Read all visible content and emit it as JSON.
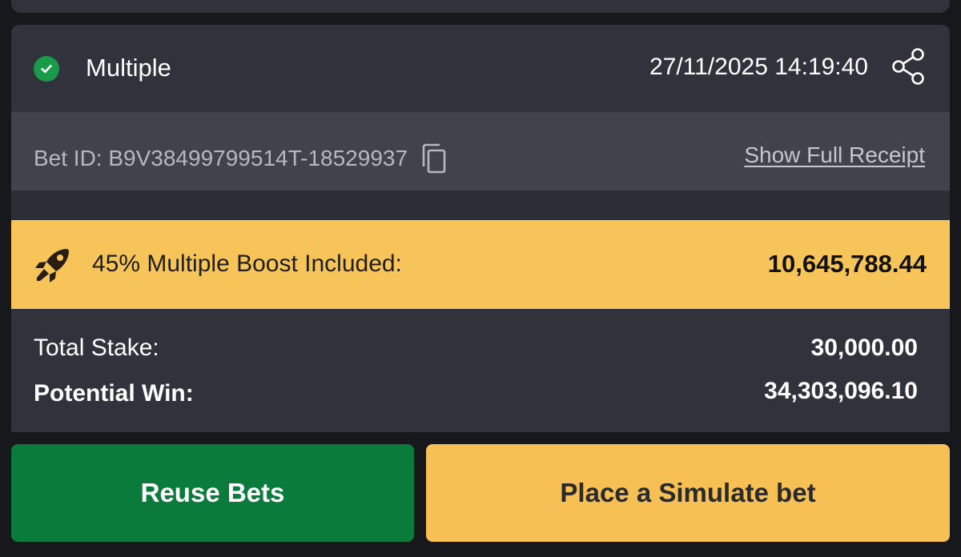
{
  "colors": {
    "card_bg": "#30333b",
    "id_row_bg": "#40434c",
    "boost_bg": "#f7c45a",
    "success_green": "#1a9b49",
    "reuse_button_bg": "#0b7b3c",
    "simulate_button_bg": "#f6c055"
  },
  "bet": {
    "status_icon": "check-circle-icon",
    "type": "Multiple",
    "datetime": "27/11/2025 14:19:40",
    "share_icon": "share-icon",
    "id_label": "Bet ID: B9V38499799514T-18529937",
    "copy_icon": "copy-icon",
    "receipt_link": "Show Full Receipt"
  },
  "boost": {
    "icon": "rocket-icon",
    "label": "45% Multiple Boost Included:",
    "value": "10,645,788.44"
  },
  "totals": {
    "stake_label": "Total Stake:",
    "stake_value": "30,000.00",
    "win_label": "Potential Win:",
    "win_value": "34,303,096.10"
  },
  "actions": {
    "reuse_label": "Reuse Bets",
    "simulate_label": "Place a Simulate bet"
  }
}
